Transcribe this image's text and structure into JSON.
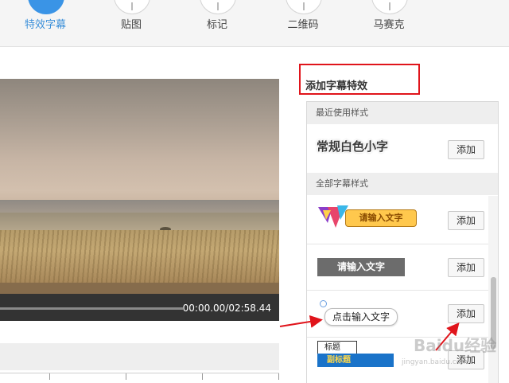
{
  "toolbar": {
    "items": [
      {
        "label": "特效字幕",
        "icon": "text-effect-icon",
        "active": true
      },
      {
        "label": "贴图",
        "icon": "sticker-icon",
        "active": false
      },
      {
        "label": "标记",
        "icon": "marker-icon",
        "active": false
      },
      {
        "label": "二维码",
        "icon": "qrcode-icon",
        "active": false
      },
      {
        "label": "马赛克",
        "icon": "mosaic-icon",
        "active": false
      }
    ],
    "active_color": "#3a94e6"
  },
  "player": {
    "time": "00:00.00/02:58.44"
  },
  "subtitle_panel": {
    "title": "添加字幕特效",
    "recent_header": "最近使用样式",
    "all_header": "全部字幕样式",
    "add_label": "添加",
    "recent_styles": [
      {
        "preview_text": "常规白色小字"
      }
    ],
    "all_styles": [
      {
        "preview_text": "请输入文字",
        "style": "orange-badge"
      },
      {
        "preview_text": "请输入文字",
        "style": "dark-box"
      },
      {
        "preview_text": "点击输入文字",
        "style": "speech-bubble"
      },
      {
        "title_text": "标题",
        "subtitle_text": "副标题",
        "style": "title-subtitle"
      }
    ]
  },
  "highlight_color": "#e0141b",
  "watermark": {
    "text": "Baidu经验",
    "sub": "jingyan.baidu.com"
  }
}
